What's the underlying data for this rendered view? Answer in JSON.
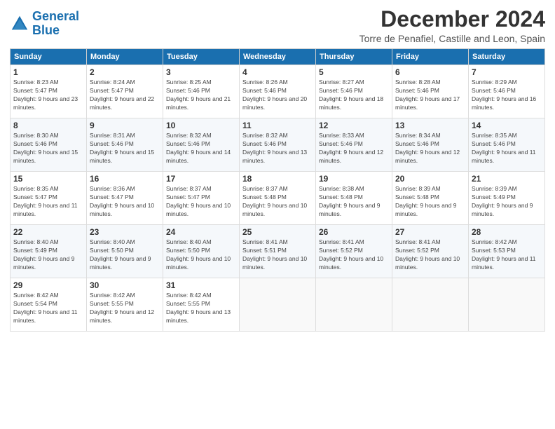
{
  "logo": {
    "line1": "General",
    "line2": "Blue"
  },
  "title": "December 2024",
  "location": "Torre de Penafiel, Castille and Leon, Spain",
  "days_header": [
    "Sunday",
    "Monday",
    "Tuesday",
    "Wednesday",
    "Thursday",
    "Friday",
    "Saturday"
  ],
  "weeks": [
    [
      {
        "day": "1",
        "sunrise": "Sunrise: 8:23 AM",
        "sunset": "Sunset: 5:47 PM",
        "daylight": "Daylight: 9 hours and 23 minutes."
      },
      {
        "day": "2",
        "sunrise": "Sunrise: 8:24 AM",
        "sunset": "Sunset: 5:47 PM",
        "daylight": "Daylight: 9 hours and 22 minutes."
      },
      {
        "day": "3",
        "sunrise": "Sunrise: 8:25 AM",
        "sunset": "Sunset: 5:46 PM",
        "daylight": "Daylight: 9 hours and 21 minutes."
      },
      {
        "day": "4",
        "sunrise": "Sunrise: 8:26 AM",
        "sunset": "Sunset: 5:46 PM",
        "daylight": "Daylight: 9 hours and 20 minutes."
      },
      {
        "day": "5",
        "sunrise": "Sunrise: 8:27 AM",
        "sunset": "Sunset: 5:46 PM",
        "daylight": "Daylight: 9 hours and 18 minutes."
      },
      {
        "day": "6",
        "sunrise": "Sunrise: 8:28 AM",
        "sunset": "Sunset: 5:46 PM",
        "daylight": "Daylight: 9 hours and 17 minutes."
      },
      {
        "day": "7",
        "sunrise": "Sunrise: 8:29 AM",
        "sunset": "Sunset: 5:46 PM",
        "daylight": "Daylight: 9 hours and 16 minutes."
      }
    ],
    [
      {
        "day": "8",
        "sunrise": "Sunrise: 8:30 AM",
        "sunset": "Sunset: 5:46 PM",
        "daylight": "Daylight: 9 hours and 15 minutes."
      },
      {
        "day": "9",
        "sunrise": "Sunrise: 8:31 AM",
        "sunset": "Sunset: 5:46 PM",
        "daylight": "Daylight: 9 hours and 15 minutes."
      },
      {
        "day": "10",
        "sunrise": "Sunrise: 8:32 AM",
        "sunset": "Sunset: 5:46 PM",
        "daylight": "Daylight: 9 hours and 14 minutes."
      },
      {
        "day": "11",
        "sunrise": "Sunrise: 8:32 AM",
        "sunset": "Sunset: 5:46 PM",
        "daylight": "Daylight: 9 hours and 13 minutes."
      },
      {
        "day": "12",
        "sunrise": "Sunrise: 8:33 AM",
        "sunset": "Sunset: 5:46 PM",
        "daylight": "Daylight: 9 hours and 12 minutes."
      },
      {
        "day": "13",
        "sunrise": "Sunrise: 8:34 AM",
        "sunset": "Sunset: 5:46 PM",
        "daylight": "Daylight: 9 hours and 12 minutes."
      },
      {
        "day": "14",
        "sunrise": "Sunrise: 8:35 AM",
        "sunset": "Sunset: 5:46 PM",
        "daylight": "Daylight: 9 hours and 11 minutes."
      }
    ],
    [
      {
        "day": "15",
        "sunrise": "Sunrise: 8:35 AM",
        "sunset": "Sunset: 5:47 PM",
        "daylight": "Daylight: 9 hours and 11 minutes."
      },
      {
        "day": "16",
        "sunrise": "Sunrise: 8:36 AM",
        "sunset": "Sunset: 5:47 PM",
        "daylight": "Daylight: 9 hours and 10 minutes."
      },
      {
        "day": "17",
        "sunrise": "Sunrise: 8:37 AM",
        "sunset": "Sunset: 5:47 PM",
        "daylight": "Daylight: 9 hours and 10 minutes."
      },
      {
        "day": "18",
        "sunrise": "Sunrise: 8:37 AM",
        "sunset": "Sunset: 5:48 PM",
        "daylight": "Daylight: 9 hours and 10 minutes."
      },
      {
        "day": "19",
        "sunrise": "Sunrise: 8:38 AM",
        "sunset": "Sunset: 5:48 PM",
        "daylight": "Daylight: 9 hours and 9 minutes."
      },
      {
        "day": "20",
        "sunrise": "Sunrise: 8:39 AM",
        "sunset": "Sunset: 5:48 PM",
        "daylight": "Daylight: 9 hours and 9 minutes."
      },
      {
        "day": "21",
        "sunrise": "Sunrise: 8:39 AM",
        "sunset": "Sunset: 5:49 PM",
        "daylight": "Daylight: 9 hours and 9 minutes."
      }
    ],
    [
      {
        "day": "22",
        "sunrise": "Sunrise: 8:40 AM",
        "sunset": "Sunset: 5:49 PM",
        "daylight": "Daylight: 9 hours and 9 minutes."
      },
      {
        "day": "23",
        "sunrise": "Sunrise: 8:40 AM",
        "sunset": "Sunset: 5:50 PM",
        "daylight": "Daylight: 9 hours and 9 minutes."
      },
      {
        "day": "24",
        "sunrise": "Sunrise: 8:40 AM",
        "sunset": "Sunset: 5:50 PM",
        "daylight": "Daylight: 9 hours and 10 minutes."
      },
      {
        "day": "25",
        "sunrise": "Sunrise: 8:41 AM",
        "sunset": "Sunset: 5:51 PM",
        "daylight": "Daylight: 9 hours and 10 minutes."
      },
      {
        "day": "26",
        "sunrise": "Sunrise: 8:41 AM",
        "sunset": "Sunset: 5:52 PM",
        "daylight": "Daylight: 9 hours and 10 minutes."
      },
      {
        "day": "27",
        "sunrise": "Sunrise: 8:41 AM",
        "sunset": "Sunset: 5:52 PM",
        "daylight": "Daylight: 9 hours and 10 minutes."
      },
      {
        "day": "28",
        "sunrise": "Sunrise: 8:42 AM",
        "sunset": "Sunset: 5:53 PM",
        "daylight": "Daylight: 9 hours and 11 minutes."
      }
    ],
    [
      {
        "day": "29",
        "sunrise": "Sunrise: 8:42 AM",
        "sunset": "Sunset: 5:54 PM",
        "daylight": "Daylight: 9 hours and 11 minutes."
      },
      {
        "day": "30",
        "sunrise": "Sunrise: 8:42 AM",
        "sunset": "Sunset: 5:55 PM",
        "daylight": "Daylight: 9 hours and 12 minutes."
      },
      {
        "day": "31",
        "sunrise": "Sunrise: 8:42 AM",
        "sunset": "Sunset: 5:55 PM",
        "daylight": "Daylight: 9 hours and 13 minutes."
      },
      null,
      null,
      null,
      null
    ]
  ]
}
